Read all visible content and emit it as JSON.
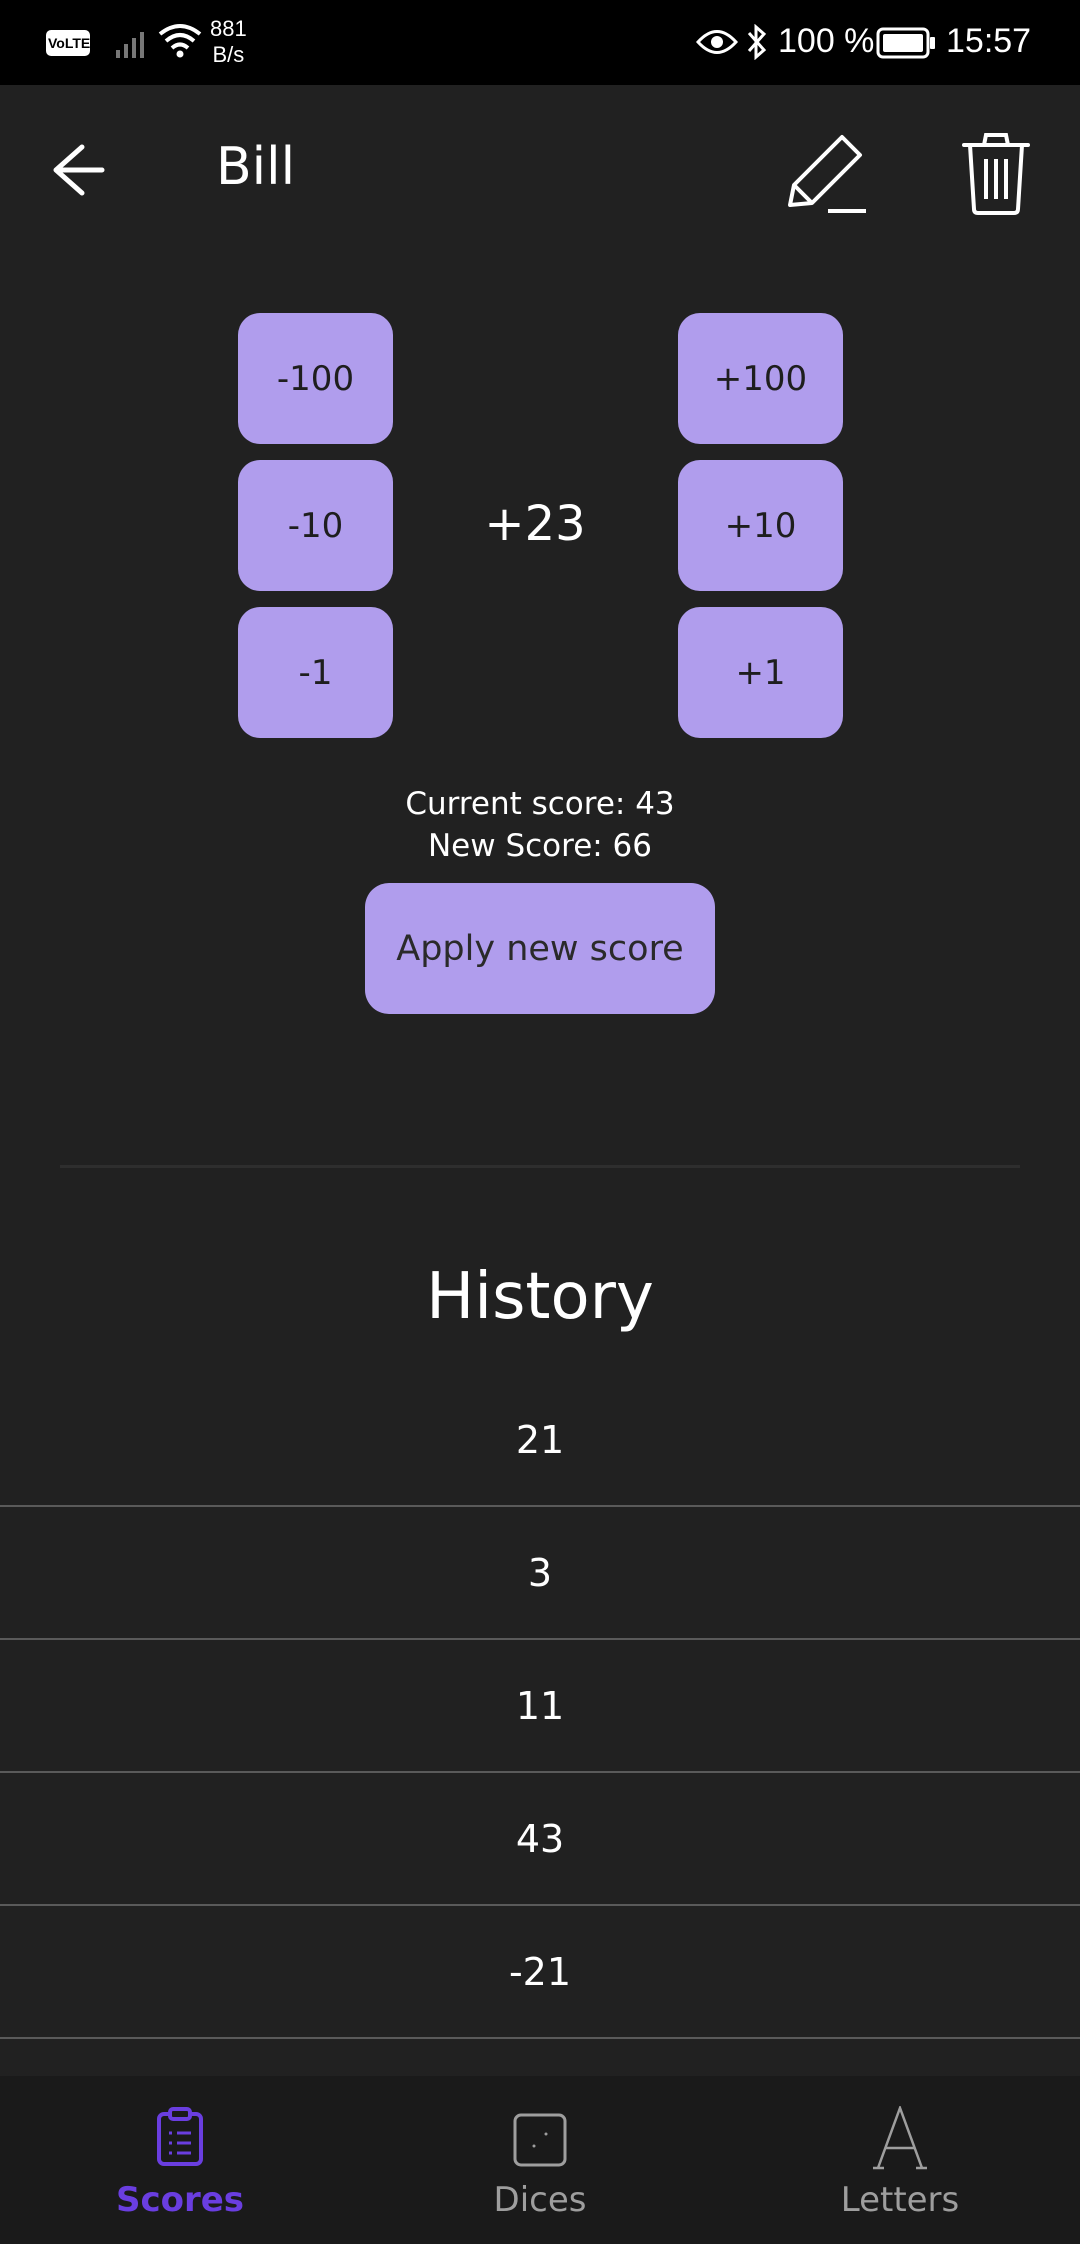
{
  "status_bar": {
    "network_badge": "VoLTE",
    "speed_value": "881",
    "speed_unit": "B/s",
    "battery_percent": "100 %",
    "time": "15:57"
  },
  "header": {
    "title": "Bill",
    "icons": [
      "back-arrow-icon",
      "pencil-icon",
      "trash-icon"
    ]
  },
  "score_controls": {
    "minus": [
      "-100",
      "-10",
      "-1"
    ],
    "plus": [
      "+100",
      "+10",
      "+1"
    ],
    "delta": "+23",
    "current_score": "Current score: 43",
    "new_score": "New Score: 66",
    "apply_label": "Apply new score"
  },
  "history": {
    "title": "History",
    "items": [
      "21",
      "3",
      "11",
      "43",
      "-21"
    ]
  },
  "bottom_nav": {
    "items": [
      {
        "label": "Scores",
        "icon": "clipboard-icon",
        "active": true
      },
      {
        "label": "Dices",
        "icon": "die-icon",
        "active": false
      },
      {
        "label": "Letters",
        "icon": "letter-a-icon",
        "active": false
      }
    ]
  },
  "colors": {
    "background": "#212121",
    "button": "#b09ded",
    "accent": "#6a3ee0",
    "status_bar": "#000000",
    "nav_bar": "#1a1a1a"
  }
}
